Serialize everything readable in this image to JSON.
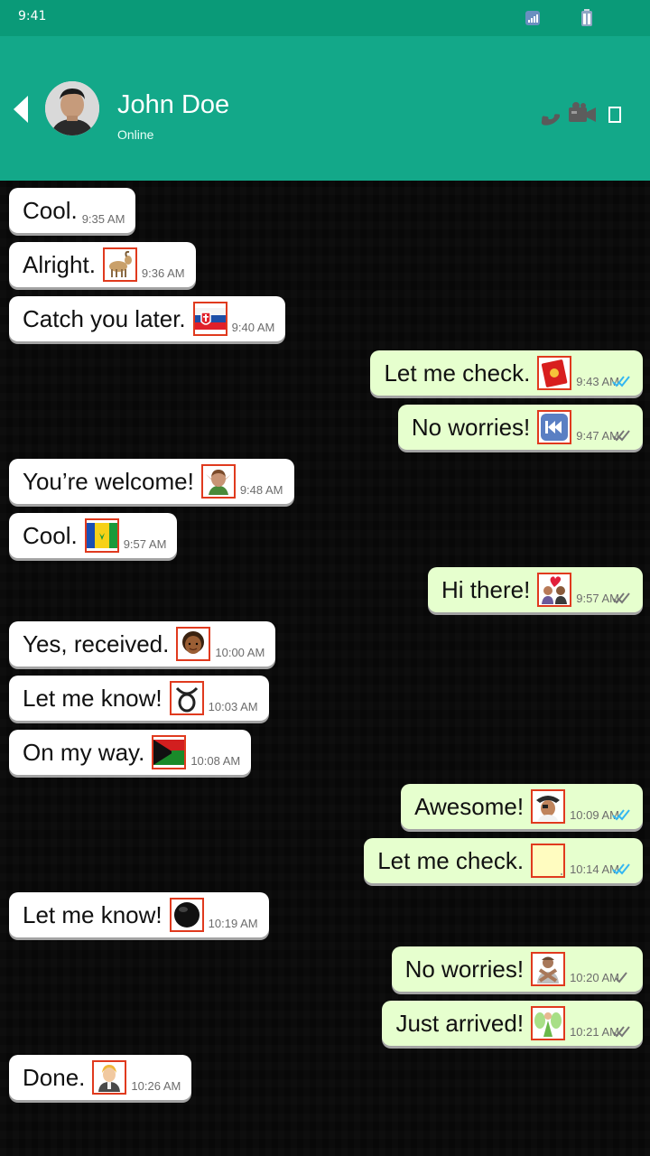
{
  "status_bar": {
    "time": "9:41"
  },
  "header": {
    "contact_name": "John Doe",
    "contact_status": "Online",
    "colors": {
      "status_bar": "#0a9a78",
      "header": "#13a889"
    }
  },
  "messages": [
    {
      "direction": "incoming",
      "text": "Cool.",
      "emoji": null,
      "time": "9:35 AM"
    },
    {
      "direction": "incoming",
      "text": "Alright.",
      "emoji": "goat-emoji",
      "time": "9:36 AM"
    },
    {
      "direction": "incoming",
      "text": "Catch you later.",
      "emoji": "slovakia-flag-emoji",
      "time": "9:40 AM"
    },
    {
      "direction": "outgoing",
      "text": "Let me check.",
      "emoji": "red-envelope-emoji",
      "time": "9:43 AM",
      "read": true
    },
    {
      "direction": "outgoing",
      "text": "No worries!",
      "emoji": "rewind-button-emoji",
      "time": "9:47 AM",
      "read": false
    },
    {
      "direction": "incoming",
      "text": "You’re welcome!",
      "emoji": "elf-emoji",
      "time": "9:48 AM"
    },
    {
      "direction": "incoming",
      "text": "Cool.",
      "emoji": "saint-vincent-flag-emoji",
      "time": "9:57 AM"
    },
    {
      "direction": "outgoing",
      "text": "Hi there!",
      "emoji": "couple-heart-emoji",
      "time": "9:57 AM",
      "read": false
    },
    {
      "direction": "incoming",
      "text": "Yes, received.",
      "emoji": "woman-face-emoji",
      "time": "10:00 AM"
    },
    {
      "direction": "incoming",
      "text": "Let me know!",
      "emoji": "curly-loop-emoji",
      "time": "10:03 AM"
    },
    {
      "direction": "incoming",
      "text": "On my way.",
      "emoji": "arakan-flag-emoji",
      "time": "10:08 AM"
    },
    {
      "direction": "outgoing",
      "text": "Awesome!",
      "emoji": "pirate-emoji",
      "time": "10:09 AM",
      "read": true
    },
    {
      "direction": "outgoing",
      "text": "Let me check.",
      "emoji": "blank-emoji",
      "time": "10:14 AM",
      "read": true
    },
    {
      "direction": "incoming",
      "text": "Let me know!",
      "emoji": "black-circle-emoji",
      "time": "10:19 AM"
    },
    {
      "direction": "outgoing",
      "text": "No worries!",
      "emoji": "person-gesturing-no-emoji",
      "time": "10:20 AM",
      "read": false,
      "single_tick": true
    },
    {
      "direction": "outgoing",
      "text": "Just arrived!",
      "emoji": "fairy-emoji",
      "time": "10:21 AM",
      "read": false
    },
    {
      "direction": "incoming",
      "text": "Done.",
      "emoji": "person-blond-emoji",
      "time": "10:26 AM"
    }
  ],
  "colors": {
    "incoming_bubble": "#ffffff",
    "outgoing_bubble": "#e6ffce",
    "read_tick": "#34b7f1",
    "unread_tick": "#777777"
  }
}
